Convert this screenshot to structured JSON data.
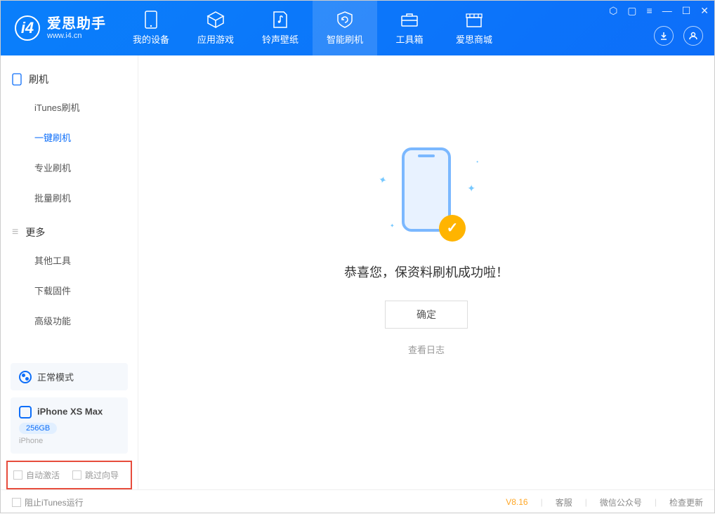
{
  "app": {
    "title": "爱思助手",
    "subtitle": "www.i4.cn"
  },
  "nav": [
    {
      "label": "我的设备"
    },
    {
      "label": "应用游戏"
    },
    {
      "label": "铃声壁纸"
    },
    {
      "label": "智能刷机"
    },
    {
      "label": "工具箱"
    },
    {
      "label": "爱思商城"
    }
  ],
  "sidebar": {
    "group1_title": "刷机",
    "group1_items": [
      "iTunes刷机",
      "一键刷机",
      "专业刷机",
      "批量刷机"
    ],
    "group2_title": "更多",
    "group2_items": [
      "其他工具",
      "下载固件",
      "高级功能"
    ]
  },
  "mode": {
    "label": "正常模式"
  },
  "device": {
    "name": "iPhone XS Max",
    "storage": "256GB",
    "type": "iPhone"
  },
  "bottom_checks": {
    "auto_activate": "自动激活",
    "skip_guide": "跳过向导"
  },
  "main": {
    "success_message": "恭喜您，保资料刷机成功啦！",
    "ok_button": "确定",
    "view_log": "查看日志"
  },
  "footer": {
    "block_itunes": "阻止iTunes运行",
    "version": "V8.16",
    "service": "客服",
    "wechat": "微信公众号",
    "update": "检查更新"
  }
}
